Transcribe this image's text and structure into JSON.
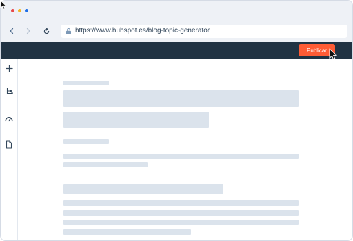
{
  "browser": {
    "url": "https://www.hubspot.es/blog-topic-generator",
    "traffic_colors": [
      "#e84a4a",
      "#f5b625",
      "#1f6fe6"
    ]
  },
  "toolbar": {
    "publish_label": "Publicar",
    "publish_color": "#ff5c35",
    "bar_color": "#213343"
  },
  "sidebar": {
    "icons": [
      "add-icon",
      "tree-structure-icon",
      "speedometer-icon",
      "document-icon"
    ]
  },
  "skeleton_color": "#dbe3ec"
}
